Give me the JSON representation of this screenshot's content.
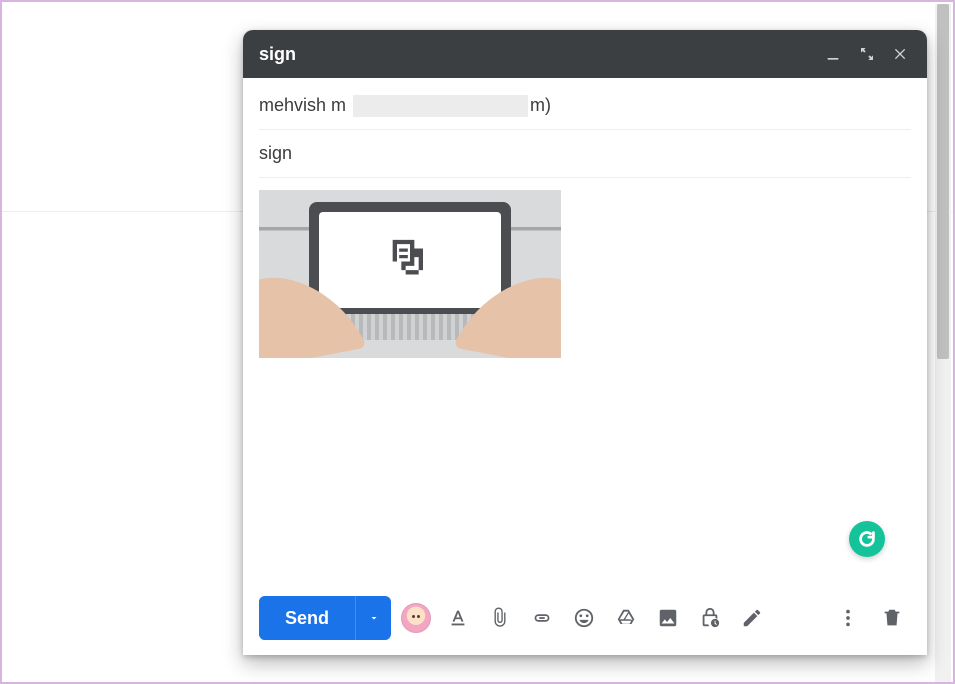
{
  "compose": {
    "title": "sign",
    "to_name": "mehvish m",
    "to_suffix": "m)",
    "subject": "sign",
    "send_label": "Send"
  },
  "icons": {
    "minimize": "minimize-icon",
    "expand": "expand-icon",
    "close": "close-icon",
    "format": "format-text-icon",
    "attach": "attach-icon",
    "link": "link-icon",
    "emoji": "emoji-icon",
    "drive": "drive-icon",
    "photo": "photo-icon",
    "confidential": "confidential-clock-icon",
    "pen": "pen-icon",
    "more": "more-vert-icon",
    "trash": "trash-icon",
    "grammarly": "grammarly-icon",
    "signature_body": "document-stack-icon"
  }
}
